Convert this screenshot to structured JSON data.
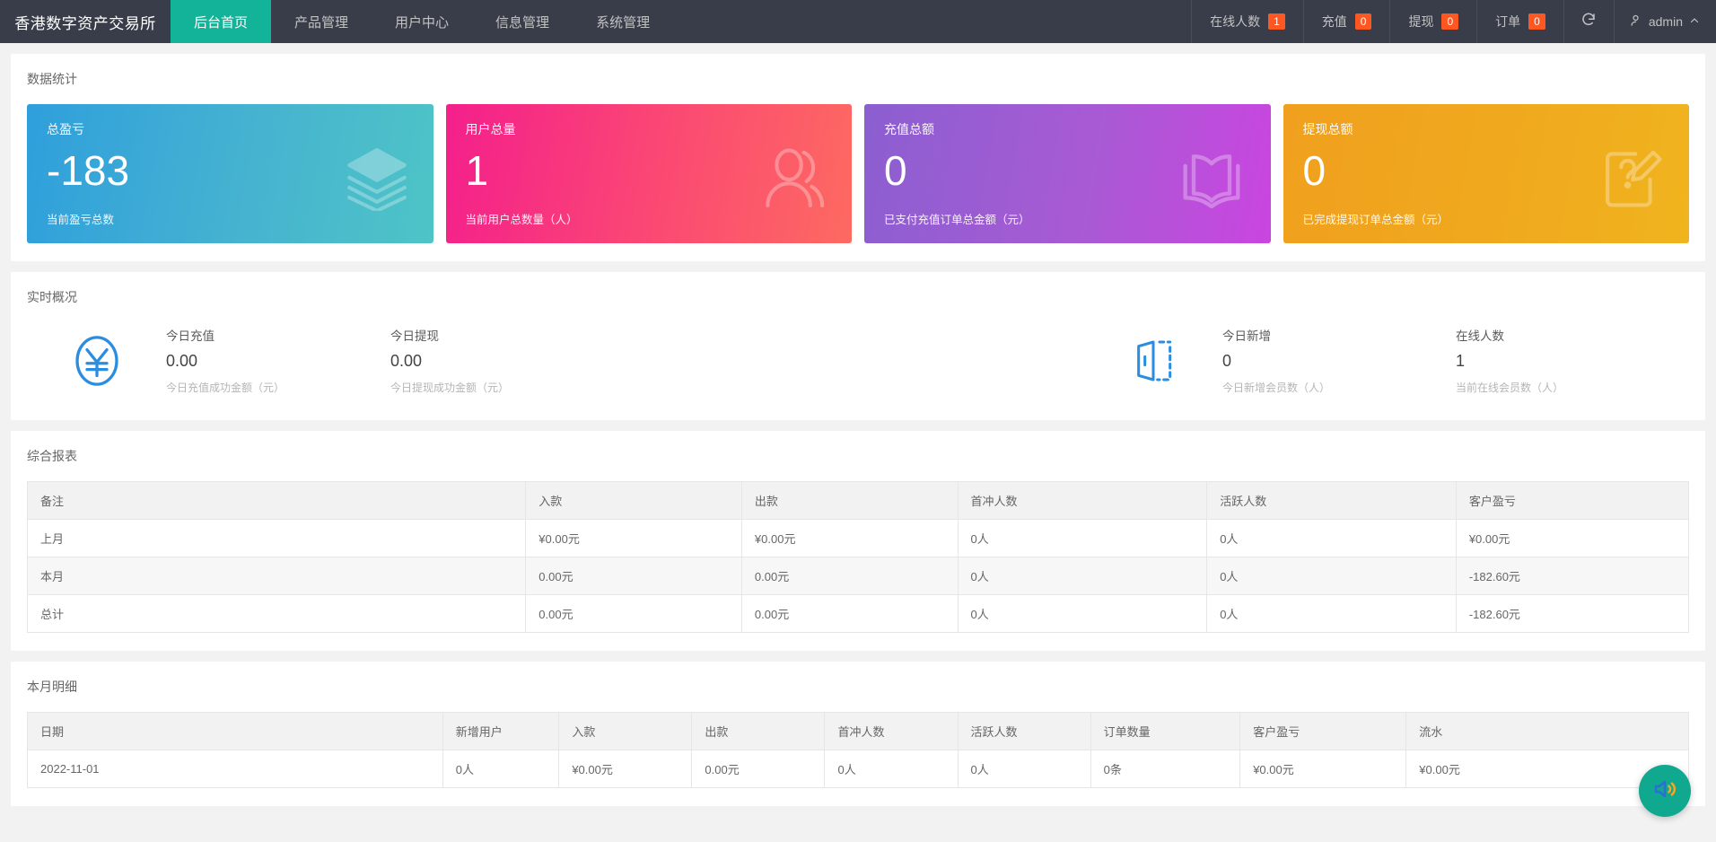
{
  "header": {
    "brand": "香港数字资产交易所",
    "nav": [
      {
        "label": "后台首页",
        "active": true
      },
      {
        "label": "产品管理",
        "active": false
      },
      {
        "label": "用户中心",
        "active": false
      },
      {
        "label": "信息管理",
        "active": false
      },
      {
        "label": "系统管理",
        "active": false
      }
    ],
    "stats": [
      {
        "label": "在线人数",
        "badge": "1"
      },
      {
        "label": "充值",
        "badge": "0"
      },
      {
        "label": "提现",
        "badge": "0"
      },
      {
        "label": "订单",
        "badge": "0"
      }
    ],
    "refresh_icon": "refresh-icon",
    "user": "admin",
    "user_icon": "user-icon",
    "caret_icon": "chevron-up-icon"
  },
  "stats_panel": {
    "title": "数据统计",
    "cards": [
      {
        "title": "总盈亏",
        "value": "-183",
        "sub": "当前盈亏总数",
        "icon": "layers-icon",
        "color": "#3aa7d4"
      },
      {
        "title": "用户总量",
        "value": "1",
        "sub": "当前用户总数量（人）",
        "icon": "user-icon",
        "color": "#fb3d7e"
      },
      {
        "title": "充值总额",
        "value": "0",
        "sub": "已支付充值订单总金额（元）",
        "icon": "book-icon",
        "color": "#ab55d6"
      },
      {
        "title": "提现总额",
        "value": "0",
        "sub": "已完成提现订单总金额（元）",
        "icon": "note-edit-icon",
        "color": "#f0a81e"
      }
    ]
  },
  "realtime_panel": {
    "title": "实时概况",
    "icon_left": "yen-circle-icon",
    "icon_mid": "door-open-icon",
    "blocks_left": [
      {
        "label": "今日充值",
        "value": "0.00",
        "sub": "今日充值成功金额（元）"
      },
      {
        "label": "今日提现",
        "value": "0.00",
        "sub": "今日提现成功金额（元）"
      }
    ],
    "blocks_right": [
      {
        "label": "今日新增",
        "value": "0",
        "sub": "今日新增会员数（人）"
      },
      {
        "label": "在线人数",
        "value": "1",
        "sub": "当前在线会员数（人）"
      }
    ]
  },
  "report_panel": {
    "title": "综合报表",
    "columns": [
      "备注",
      "入款",
      "出款",
      "首冲人数",
      "活跃人数",
      "客户盈亏"
    ],
    "rows": [
      [
        "上月",
        "¥0.00元",
        "¥0.00元",
        "0人",
        "0人",
        "¥0.00元"
      ],
      [
        "本月",
        "0.00元",
        "0.00元",
        "0人",
        "0人",
        "-182.60元"
      ],
      [
        "总计",
        "0.00元",
        "0.00元",
        "0人",
        "0人",
        "-182.60元"
      ]
    ]
  },
  "detail_panel": {
    "title": "本月明细",
    "columns": [
      "日期",
      "新增用户",
      "入款",
      "出款",
      "首冲人数",
      "活跃人数",
      "订单数量",
      "客户盈亏",
      "流水"
    ],
    "rows": [
      [
        "2022-11-01",
        "0人",
        "¥0.00元",
        "0.00元",
        "0人",
        "0人",
        "0条",
        "¥0.00元",
        "¥0.00元"
      ]
    ]
  },
  "fab": {
    "icon": "sound-volume-icon"
  }
}
